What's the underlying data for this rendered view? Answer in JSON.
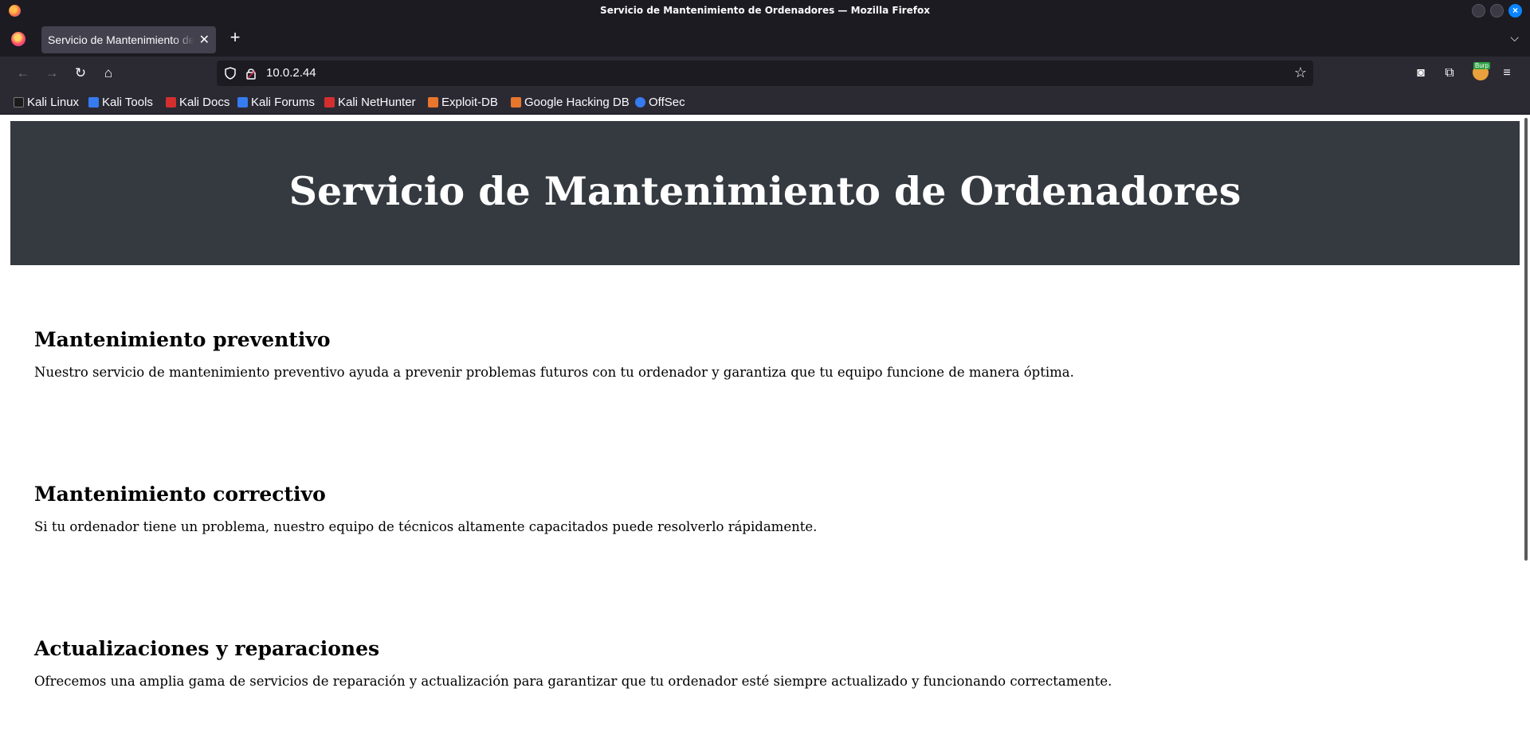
{
  "window": {
    "title": "Servicio de Mantenimiento de Ordenadores — Mozilla Firefox"
  },
  "tabs": [
    {
      "label": "Servicio de Mantenimiento de Ordenadores"
    }
  ],
  "navbar": {
    "url": "10.0.2.44",
    "burp_badge": "Burp"
  },
  "bookmarks": [
    {
      "label": "Kali Linux",
      "icon_color": "#1b1b1b"
    },
    {
      "label": "Kali Tools",
      "icon_color": "#367bf0"
    },
    {
      "label": "Kali Docs",
      "icon_color": "#d32f2f"
    },
    {
      "label": "Kali Forums",
      "icon_color": "#367bf0"
    },
    {
      "label": "Kali NetHunter",
      "icon_color": "#d32f2f"
    },
    {
      "label": "Exploit-DB",
      "icon_color": "#e8762d"
    },
    {
      "label": "Google Hacking DB",
      "icon_color": "#e8762d"
    },
    {
      "label": "OffSec",
      "icon_color": "#367bf0"
    }
  ],
  "page": {
    "title": "Servicio de Mantenimiento de Ordenadores",
    "header_bg": "#343a40",
    "sections": [
      {
        "heading": "Mantenimiento preventivo",
        "body": "Nuestro servicio de mantenimiento preventivo ayuda a prevenir problemas futuros con tu ordenador y garantiza que tu equipo funcione de manera óptima."
      },
      {
        "heading": "Mantenimiento correctivo",
        "body": "Si tu ordenador tiene un problema, nuestro equipo de técnicos altamente capacitados puede resolverlo rápidamente."
      },
      {
        "heading": "Actualizaciones y reparaciones",
        "body": "Ofrecemos una amplia gama de servicios de reparación y actualización para garantizar que tu ordenador esté siempre actualizado y funcionando correctamente."
      }
    ]
  }
}
